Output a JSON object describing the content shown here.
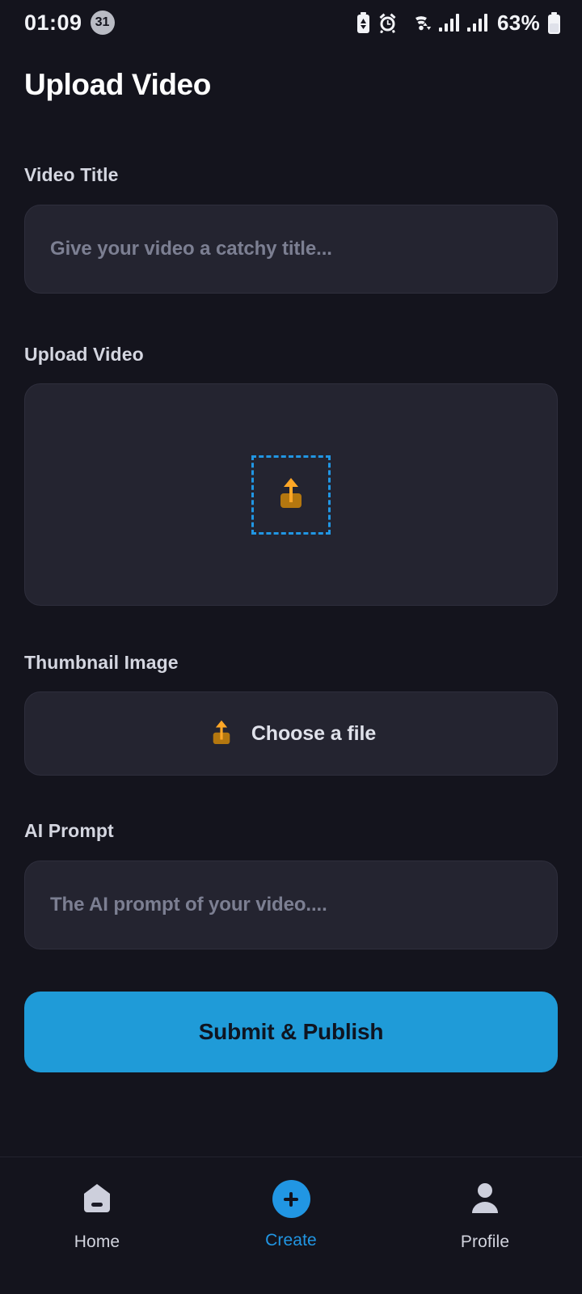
{
  "status_bar": {
    "time": "01:09",
    "notification_badge": "31",
    "battery_percent": "63%",
    "icons": [
      "battery-saver-icon",
      "alarm-icon",
      "wifi-icon",
      "signal-sim1-icon",
      "signal-sim2-icon",
      "battery-icon"
    ]
  },
  "header": {
    "title": "Upload Video"
  },
  "form": {
    "video_title": {
      "label": "Video Title",
      "value": "",
      "placeholder": "Give your video a catchy title..."
    },
    "upload_video": {
      "label": "Upload Video",
      "dropzone_icon": "upload-tray-icon"
    },
    "thumbnail": {
      "label": "Thumbnail Image",
      "button_label": "Choose a file",
      "button_icon": "upload-tray-icon"
    },
    "ai_prompt": {
      "label": "AI Prompt",
      "value": "",
      "placeholder": "The AI prompt of your video...."
    },
    "submit_label": "Submit & Publish"
  },
  "bottom_nav": {
    "items": [
      {
        "label": "Home",
        "icon": "home-icon",
        "active": false
      },
      {
        "label": "Create",
        "icon": "plus-circle-icon",
        "active": true
      },
      {
        "label": "Profile",
        "icon": "person-icon",
        "active": false
      }
    ]
  },
  "colors": {
    "background": "#14141d",
    "surface": "#242430",
    "accent": "#2196e3",
    "submit": "#1f9bd8",
    "dashed_border": "#2196e3",
    "placeholder_text": "#7c7f92",
    "label_text": "#d4d6e0",
    "upload_icon_tray": "#b4770f",
    "upload_icon_arrow": "#ffa726"
  }
}
